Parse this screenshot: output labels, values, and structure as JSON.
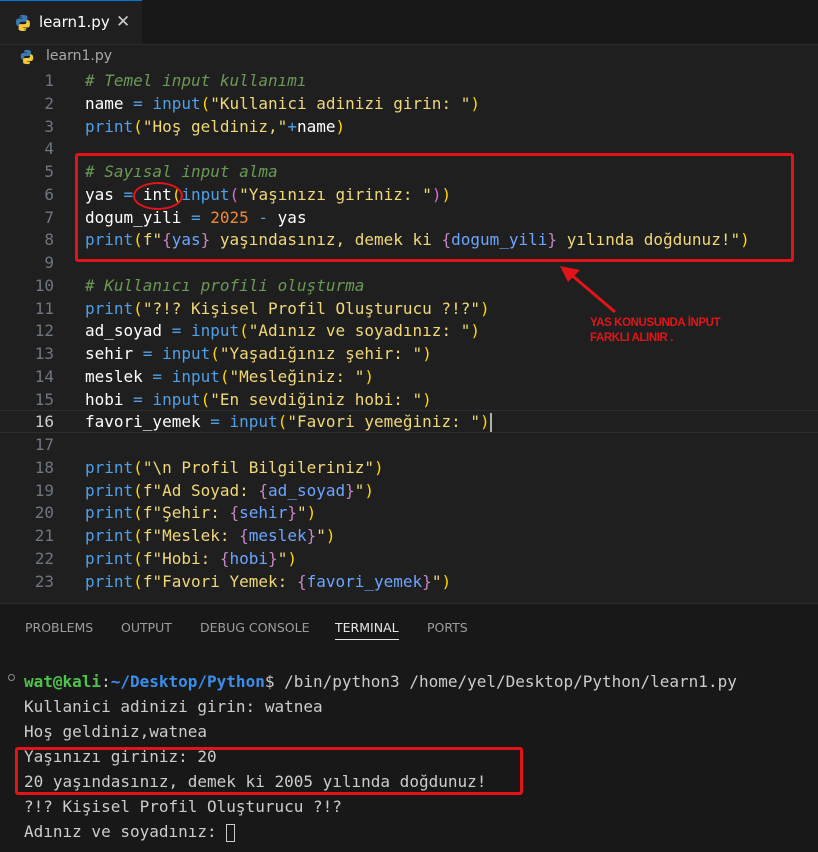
{
  "tab": {
    "label": "learn1.py",
    "close": "✕"
  },
  "breadcrumb": {
    "file": "learn1.py"
  },
  "editor": {
    "lines": [
      {
        "n": "1",
        "segs": [
          {
            "t": "# Temel input kullanımı",
            "c": "cm"
          }
        ]
      },
      {
        "n": "2",
        "segs": [
          {
            "t": "name",
            "c": "var"
          },
          {
            "t": " = ",
            "c": "op"
          },
          {
            "t": "input",
            "c": "fn"
          },
          {
            "t": "(",
            "c": "pr1"
          },
          {
            "t": "\"Kullanici adinizi girin: \"",
            "c": "str"
          },
          {
            "t": ")",
            "c": "pr1"
          }
        ]
      },
      {
        "n": "3",
        "segs": [
          {
            "t": "print",
            "c": "fn"
          },
          {
            "t": "(",
            "c": "pr1"
          },
          {
            "t": "\"Hoş geldiniz,\"",
            "c": "str"
          },
          {
            "t": "+",
            "c": "op"
          },
          {
            "t": "name",
            "c": "var"
          },
          {
            "t": ")",
            "c": "pr1"
          }
        ]
      },
      {
        "n": "4",
        "segs": []
      },
      {
        "n": "5",
        "segs": [
          {
            "t": "# Sayısal input alma",
            "c": "cm"
          }
        ]
      },
      {
        "n": "6",
        "segs": [
          {
            "t": "yas",
            "c": "var"
          },
          {
            "t": " = ",
            "c": "op"
          },
          {
            "t": "int",
            "c": "var"
          },
          {
            "t": "(",
            "c": "pr1"
          },
          {
            "t": "input",
            "c": "fn"
          },
          {
            "t": "(",
            "c": "pr2"
          },
          {
            "t": "\"Yaşınızı giriniz: \"",
            "c": "str"
          },
          {
            "t": ")",
            "c": "pr2"
          },
          {
            "t": ")",
            "c": "pr1"
          }
        ]
      },
      {
        "n": "7",
        "segs": [
          {
            "t": "dogum_yili",
            "c": "var"
          },
          {
            "t": " = ",
            "c": "op"
          },
          {
            "t": "2025",
            "c": "num"
          },
          {
            "t": " - ",
            "c": "op"
          },
          {
            "t": "yas",
            "c": "var"
          }
        ]
      },
      {
        "n": "8",
        "segs": [
          {
            "t": "print",
            "c": "fn"
          },
          {
            "t": "(",
            "c": "pr1"
          },
          {
            "t": "f\"",
            "c": "str"
          },
          {
            "t": "{",
            "c": "brace"
          },
          {
            "t": "yas",
            "c": "interp"
          },
          {
            "t": "}",
            "c": "brace"
          },
          {
            "t": " yaşındasınız, demek ki ",
            "c": "str"
          },
          {
            "t": "{",
            "c": "brace"
          },
          {
            "t": "dogum_yili",
            "c": "interp"
          },
          {
            "t": "}",
            "c": "brace"
          },
          {
            "t": " yılında doğdunuz!\"",
            "c": "str"
          },
          {
            "t": ")",
            "c": "pr1"
          }
        ]
      },
      {
        "n": "9",
        "segs": []
      },
      {
        "n": "10",
        "segs": [
          {
            "t": "# Kullanıcı profili oluşturma",
            "c": "cm"
          }
        ]
      },
      {
        "n": "11",
        "segs": [
          {
            "t": "print",
            "c": "fn"
          },
          {
            "t": "(",
            "c": "pr1"
          },
          {
            "t": "\"?!? Kişisel Profil Oluşturucu ?!?\"",
            "c": "str"
          },
          {
            "t": ")",
            "c": "pr1"
          }
        ]
      },
      {
        "n": "12",
        "segs": [
          {
            "t": "ad_soyad",
            "c": "var"
          },
          {
            "t": " = ",
            "c": "op"
          },
          {
            "t": "input",
            "c": "fn"
          },
          {
            "t": "(",
            "c": "pr1"
          },
          {
            "t": "\"Adınız ve soyadınız: \"",
            "c": "str"
          },
          {
            "t": ")",
            "c": "pr1"
          }
        ]
      },
      {
        "n": "13",
        "segs": [
          {
            "t": "sehir",
            "c": "var"
          },
          {
            "t": " = ",
            "c": "op"
          },
          {
            "t": "input",
            "c": "fn"
          },
          {
            "t": "(",
            "c": "pr1"
          },
          {
            "t": "\"Yaşadığınız şehir: \"",
            "c": "str"
          },
          {
            "t": ")",
            "c": "pr1"
          }
        ]
      },
      {
        "n": "14",
        "segs": [
          {
            "t": "meslek",
            "c": "var"
          },
          {
            "t": " = ",
            "c": "op"
          },
          {
            "t": "input",
            "c": "fn"
          },
          {
            "t": "(",
            "c": "pr1"
          },
          {
            "t": "\"Mesleğiniz: \"",
            "c": "str"
          },
          {
            "t": ")",
            "c": "pr1"
          }
        ]
      },
      {
        "n": "15",
        "segs": [
          {
            "t": "hobi",
            "c": "var"
          },
          {
            "t": " = ",
            "c": "op"
          },
          {
            "t": "input",
            "c": "fn"
          },
          {
            "t": "(",
            "c": "pr1"
          },
          {
            "t": "\"En sevdiğiniz hobi: \"",
            "c": "str"
          },
          {
            "t": ")",
            "c": "pr1"
          }
        ]
      },
      {
        "n": "16",
        "active": true,
        "segs": [
          {
            "t": "favori_yemek",
            "c": "var"
          },
          {
            "t": " = ",
            "c": "op"
          },
          {
            "t": "input",
            "c": "fn"
          },
          {
            "t": "(",
            "c": "pr1"
          },
          {
            "t": "\"Favori yemeğiniz: \"",
            "c": "str"
          },
          {
            "t": ")",
            "c": "pr1"
          }
        ]
      },
      {
        "n": "17",
        "segs": []
      },
      {
        "n": "18",
        "segs": [
          {
            "t": "print",
            "c": "fn"
          },
          {
            "t": "(",
            "c": "pr1"
          },
          {
            "t": "\"\\n Profil Bilgileriniz\"",
            "c": "str"
          },
          {
            "t": ")",
            "c": "pr1"
          }
        ]
      },
      {
        "n": "19",
        "segs": [
          {
            "t": "print",
            "c": "fn"
          },
          {
            "t": "(",
            "c": "pr1"
          },
          {
            "t": "f\"Ad Soyad: ",
            "c": "str"
          },
          {
            "t": "{",
            "c": "brace"
          },
          {
            "t": "ad_soyad",
            "c": "interp"
          },
          {
            "t": "}",
            "c": "brace"
          },
          {
            "t": "\"",
            "c": "str"
          },
          {
            "t": ")",
            "c": "pr1"
          }
        ]
      },
      {
        "n": "20",
        "segs": [
          {
            "t": "print",
            "c": "fn"
          },
          {
            "t": "(",
            "c": "pr1"
          },
          {
            "t": "f\"Şehir: ",
            "c": "str"
          },
          {
            "t": "{",
            "c": "brace"
          },
          {
            "t": "sehir",
            "c": "interp"
          },
          {
            "t": "}",
            "c": "brace"
          },
          {
            "t": "\"",
            "c": "str"
          },
          {
            "t": ")",
            "c": "pr1"
          }
        ]
      },
      {
        "n": "21",
        "segs": [
          {
            "t": "print",
            "c": "fn"
          },
          {
            "t": "(",
            "c": "pr1"
          },
          {
            "t": "f\"Meslek: ",
            "c": "str"
          },
          {
            "t": "{",
            "c": "brace"
          },
          {
            "t": "meslek",
            "c": "interp"
          },
          {
            "t": "}",
            "c": "brace"
          },
          {
            "t": "\"",
            "c": "str"
          },
          {
            "t": ")",
            "c": "pr1"
          }
        ]
      },
      {
        "n": "22",
        "segs": [
          {
            "t": "print",
            "c": "fn"
          },
          {
            "t": "(",
            "c": "pr1"
          },
          {
            "t": "f\"Hobi: ",
            "c": "str"
          },
          {
            "t": "{",
            "c": "brace"
          },
          {
            "t": "hobi",
            "c": "interp"
          },
          {
            "t": "}",
            "c": "brace"
          },
          {
            "t": "\"",
            "c": "str"
          },
          {
            "t": ")",
            "c": "pr1"
          }
        ]
      },
      {
        "n": "23",
        "segs": [
          {
            "t": "print",
            "c": "fn"
          },
          {
            "t": "(",
            "c": "pr1"
          },
          {
            "t": "f\"Favori Yemek: ",
            "c": "str"
          },
          {
            "t": "{",
            "c": "brace"
          },
          {
            "t": "favori_yemek",
            "c": "interp"
          },
          {
            "t": "}",
            "c": "brace"
          },
          {
            "t": "\"",
            "c": "str"
          },
          {
            "t": ")",
            "c": "pr1"
          }
        ]
      }
    ]
  },
  "annotation": {
    "line1": "YAS KONUSUNDA İNPUT",
    "line2": "FARKLI ALINIR ."
  },
  "panel": {
    "tabs": [
      "PROBLEMS",
      "OUTPUT",
      "DEBUG CONSOLE",
      "TERMINAL",
      "PORTS"
    ],
    "active_tab": "TERMINAL"
  },
  "terminal": {
    "user": "wat@kali",
    "sep": ":",
    "path": "~/Desktop/Python",
    "command": "$ /bin/python3 /home/yel/Desktop/Python/learn1.py",
    "output": [
      "Kullanici adinizi girin: watnea",
      "Hoş geldiniz,watnea",
      "Yaşınızı giriniz: 20",
      "20 yaşındasınız, demek ki 2005 yılında doğdunuz!",
      "?!? Kişisel Profil Oluşturucu ?!?",
      "Adınız ve soyadınız: "
    ]
  },
  "colors": {
    "annotation_red": "#e2141a",
    "accent": "#0078d4"
  }
}
